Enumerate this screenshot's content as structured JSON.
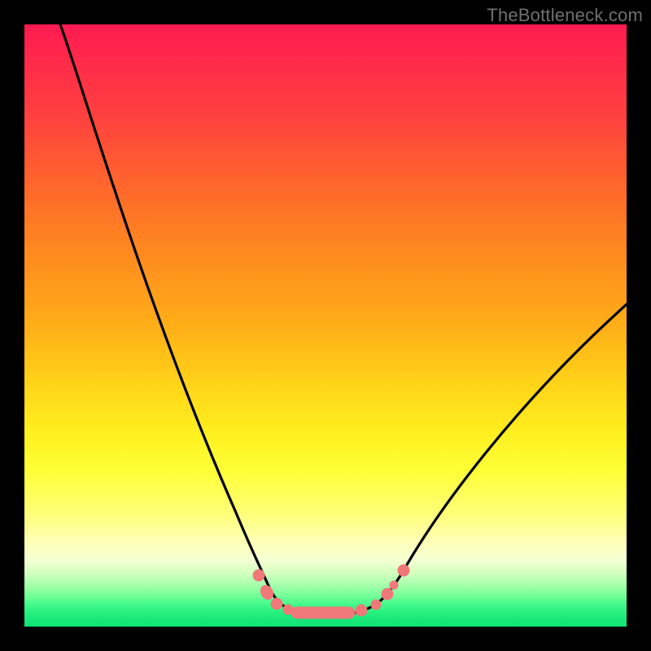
{
  "watermark": "TheBottleneck.com",
  "colors": {
    "background": "#000000",
    "gradient_top": "#ff1a52",
    "gradient_mid": "#ffff36",
    "gradient_bottom": "#11e576",
    "curve": "#000000",
    "marker": "#f07878",
    "watermark": "#707070"
  },
  "chart_data": {
    "type": "line",
    "title": "",
    "xlabel": "",
    "ylabel": "",
    "xlim": [
      0,
      100
    ],
    "ylim": [
      0,
      100
    ],
    "series": [
      {
        "name": "bottleneck-curve",
        "x": [
          6,
          10,
          15,
          20,
          25,
          30,
          34,
          37,
          38.5,
          40,
          42,
          45,
          48,
          50,
          52,
          55,
          58,
          60,
          62,
          65,
          70,
          75,
          80,
          85,
          90,
          95,
          100
        ],
        "y": [
          100,
          87,
          74,
          61,
          48,
          36,
          24,
          13,
          9,
          6,
          4,
          2.5,
          2,
          2,
          2,
          2.5,
          3.2,
          4.5,
          6,
          10,
          17,
          24,
          31,
          37,
          43,
          48.5,
          53.5
        ]
      },
      {
        "name": "min-region-markers",
        "x": [
          38.5,
          40.5,
          42,
          45,
          48,
          50,
          52,
          55,
          57,
          58.5,
          60
        ],
        "y": [
          9,
          5.2,
          4,
          2.5,
          2,
          2,
          2,
          2.5,
          3,
          3.6,
          4.5
        ]
      }
    ],
    "annotations": []
  }
}
